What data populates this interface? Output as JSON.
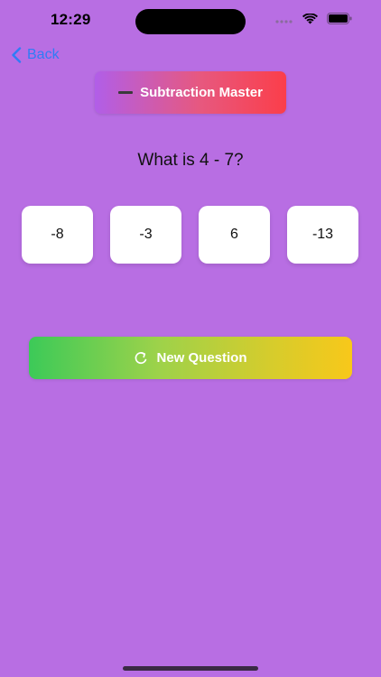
{
  "status_bar": {
    "time": "12:29",
    "icons": [
      "signal-icon",
      "wifi-icon",
      "battery-icon"
    ]
  },
  "nav": {
    "back_label": "Back",
    "back_icon": "chevron-left-icon"
  },
  "header": {
    "title": "Subtraction Master",
    "icon": "minus-icon"
  },
  "quiz": {
    "question": "What is 4 - 7?",
    "answers": [
      "-8",
      "-3",
      "6",
      "-13"
    ]
  },
  "actions": {
    "new_question_label": "New Question",
    "new_question_icon": "refresh-icon"
  },
  "colors": {
    "background": "#b86ee3",
    "link": "#2f7cf6",
    "title_gradient": [
      "#b15ee8",
      "#fb3e4a"
    ],
    "button_gradient": [
      "#3cca58",
      "#f8c81a"
    ]
  }
}
